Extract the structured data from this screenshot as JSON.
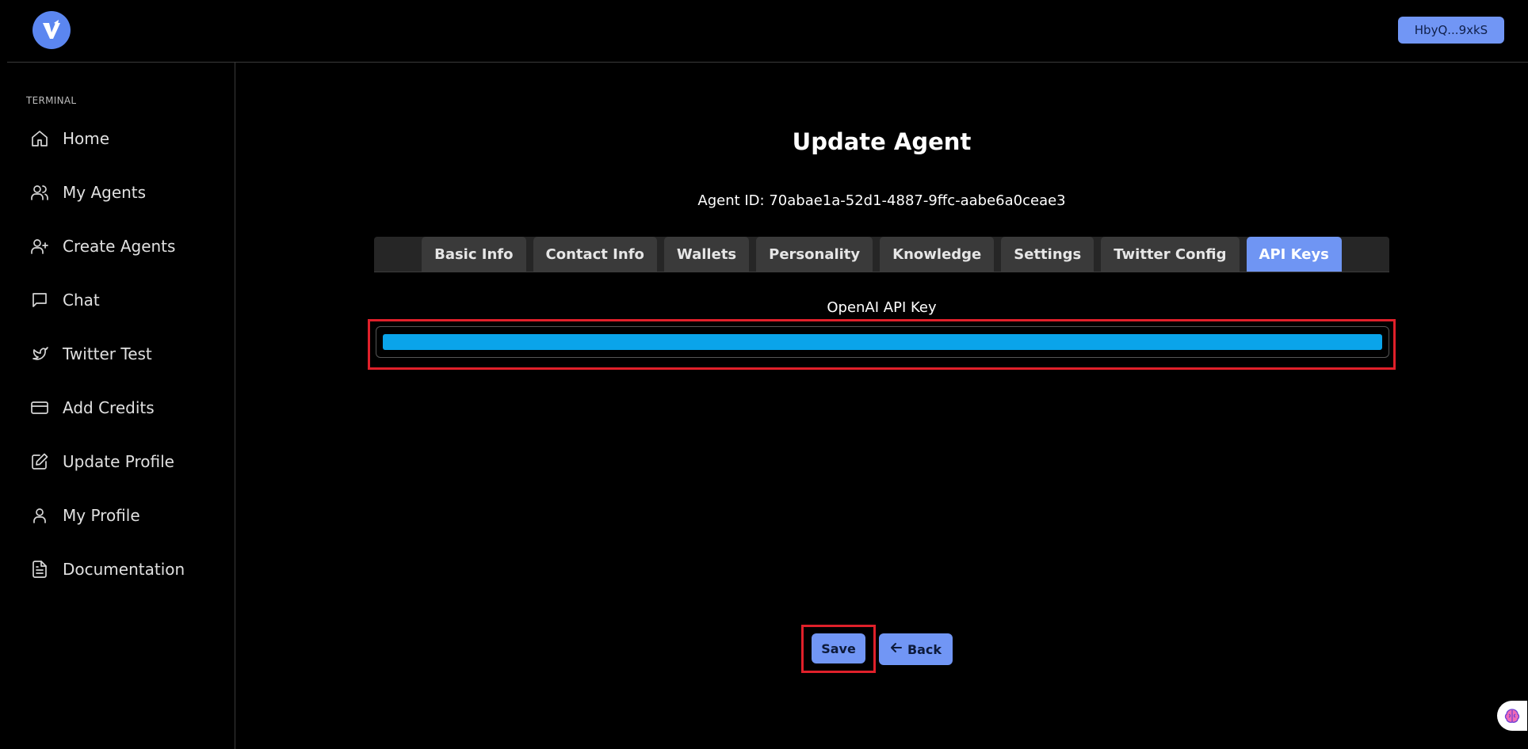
{
  "header": {
    "wallet_label": "HbyQ...9xkS",
    "brand_color": "#5b86f0"
  },
  "sidebar": {
    "section_label": "TERMINAL",
    "items": [
      {
        "label": "Home",
        "icon": "home-icon"
      },
      {
        "label": "My Agents",
        "icon": "users-icon"
      },
      {
        "label": "Create Agents",
        "icon": "user-plus-icon"
      },
      {
        "label": "Chat",
        "icon": "chat-icon"
      },
      {
        "label": "Twitter Test",
        "icon": "twitter-icon"
      },
      {
        "label": "Add Credits",
        "icon": "credit-card-icon"
      },
      {
        "label": "Update Profile",
        "icon": "edit-icon"
      },
      {
        "label": "My Profile",
        "icon": "user-icon"
      },
      {
        "label": "Documentation",
        "icon": "document-icon"
      }
    ]
  },
  "main": {
    "title": "Update Agent",
    "agent_id": "Agent ID: 70abae1a-52d1-4887-9ffc-aabe6a0ceae3",
    "tabs": [
      {
        "label": "Basic Info",
        "active": false
      },
      {
        "label": "Contact Info",
        "active": false
      },
      {
        "label": "Wallets",
        "active": false
      },
      {
        "label": "Personality",
        "active": false
      },
      {
        "label": "Knowledge",
        "active": false
      },
      {
        "label": "Settings",
        "active": false
      },
      {
        "label": "Twitter Config",
        "active": false
      },
      {
        "label": "API Keys",
        "active": true
      }
    ],
    "openai_label": "OpenAI API Key",
    "save_label": "Save",
    "back_label": "Back"
  },
  "colors": {
    "accent": "#7196f5",
    "active_tab": "#6f95f3",
    "highlight": "#e0202a",
    "selection": "#0aa4ea"
  }
}
